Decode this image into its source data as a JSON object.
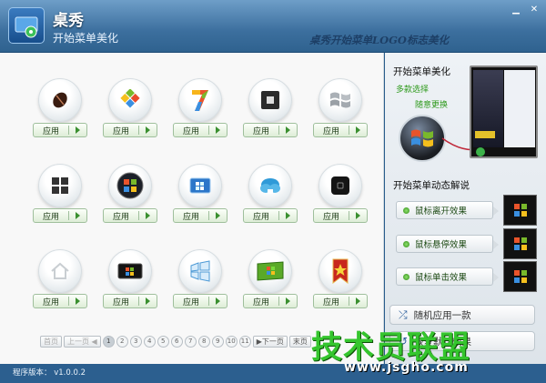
{
  "header": {
    "title": "桌秀",
    "subtitle": "开始菜单美化",
    "slogan": "桌秀开始菜单LOGO标志美化"
  },
  "window": {
    "min_label": "▁",
    "close_label": "✕"
  },
  "icons": [
    {
      "name": "coffee-bean-icon",
      "apply": "应用"
    },
    {
      "name": "windows-tiles-icon",
      "apply": "应用"
    },
    {
      "name": "windows7-number-icon",
      "apply": "应用"
    },
    {
      "name": "square-stop-icon",
      "apply": "应用"
    },
    {
      "name": "windows-flag-grey-icon",
      "apply": "应用"
    },
    {
      "name": "four-squares-icon",
      "apply": "应用"
    },
    {
      "name": "windows-orb-icon",
      "apply": "应用"
    },
    {
      "name": "blue-window-card-icon",
      "apply": "应用"
    },
    {
      "name": "cloud-icon",
      "apply": "应用"
    },
    {
      "name": "dark-square-button-icon",
      "apply": "应用"
    },
    {
      "name": "house-icon",
      "apply": "应用"
    },
    {
      "name": "windows-black-card-icon",
      "apply": "应用"
    },
    {
      "name": "windows-outline-icon",
      "apply": "应用"
    },
    {
      "name": "windows-green-banner-icon",
      "apply": "应用"
    },
    {
      "name": "red-star-banner-icon",
      "apply": "应用"
    }
  ],
  "pager": {
    "first": "首页",
    "prev": "上一页",
    "pages": [
      "1",
      "2",
      "3",
      "4",
      "5",
      "6",
      "7",
      "8",
      "9",
      "10",
      "11"
    ],
    "next": "下一页",
    "last": "末页"
  },
  "side": {
    "section1_title": "开始菜单美化",
    "tag1": "多款选择",
    "tag2": "随意更换",
    "section2_title": "开始菜单动态解说",
    "effects": [
      "鼠标离开效果",
      "鼠标悬停效果",
      "鼠标单击效果"
    ],
    "random_apply": "随机应用一款",
    "restore_default": "恢复默认效果"
  },
  "status": {
    "version_label": "程序版本：",
    "version": "v1.0.0.2"
  },
  "watermark": {
    "text": "技术员联盟",
    "url": "www.jsgho.com"
  }
}
